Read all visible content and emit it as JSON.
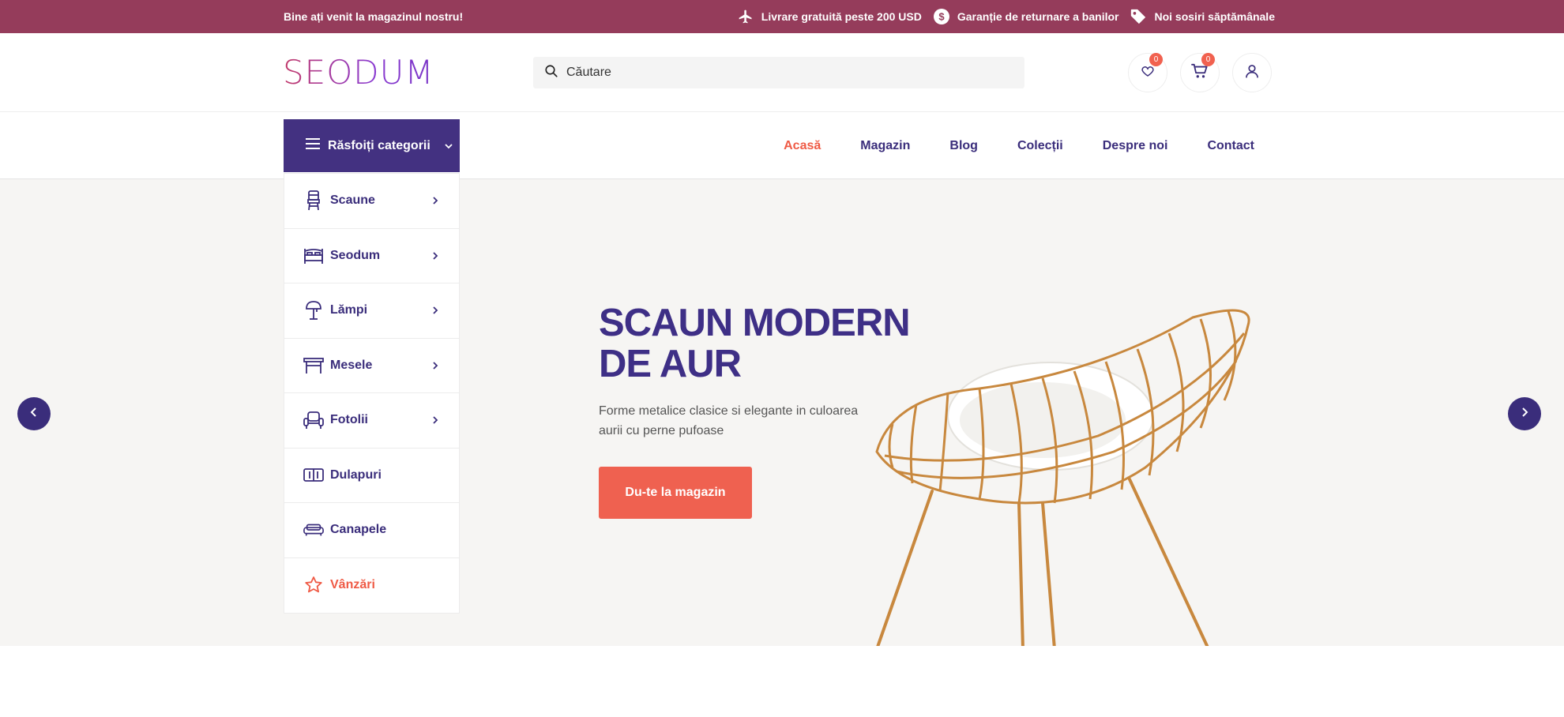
{
  "topbar": {
    "welcome": "Bine ați venit la magazinul nostru!",
    "perks": [
      {
        "icon": "airplane-icon",
        "label": "Livrare gratuită peste 200 USD"
      },
      {
        "icon": "dollar-icon",
        "label": "Garanție de returnare a banilor"
      },
      {
        "icon": "tag-icon",
        "label": "Noi sosiri săptămânale"
      }
    ],
    "background": "#953c5b"
  },
  "header": {
    "logo_text": "SEODUM",
    "search_placeholder": "Căutare",
    "wishlist_count": "0",
    "cart_count": "0"
  },
  "nav": {
    "browse_label": "Răsfoiți categorii",
    "menu": [
      {
        "label": "Acasă",
        "active": true
      },
      {
        "label": "Magazin"
      },
      {
        "label": "Blog"
      },
      {
        "label": "Colecții"
      },
      {
        "label": "Despre noi"
      },
      {
        "label": "Contact"
      }
    ]
  },
  "categories": [
    {
      "label": "Scaune",
      "icon": "chair-icon",
      "submenu": true
    },
    {
      "label": "Seodum",
      "icon": "bed-icon",
      "submenu": true
    },
    {
      "label": "Lămpi",
      "icon": "lamp-icon",
      "submenu": true
    },
    {
      "label": "Mesele",
      "icon": "table-icon",
      "submenu": true
    },
    {
      "label": "Fotolii",
      "icon": "armchair-icon",
      "submenu": true
    },
    {
      "label": "Dulapuri",
      "icon": "wardrobe-icon",
      "submenu": false
    },
    {
      "label": "Canapele",
      "icon": "sofa-icon",
      "submenu": false
    },
    {
      "label": "Vânzări",
      "icon": "star-icon",
      "submenu": false
    }
  ],
  "hero": {
    "title_line1": "SCAUN MODERN",
    "title_line2": "DE AUR",
    "subtitle": "Forme metalice clasice si elegante in culoarea aurii cu perne pufoase",
    "button_label": "Du-te la magazin"
  },
  "colors": {
    "primary": "#433181",
    "accent": "#ef6150",
    "topbar": "#953c5b",
    "hero_bg": "#f6f5f3"
  }
}
